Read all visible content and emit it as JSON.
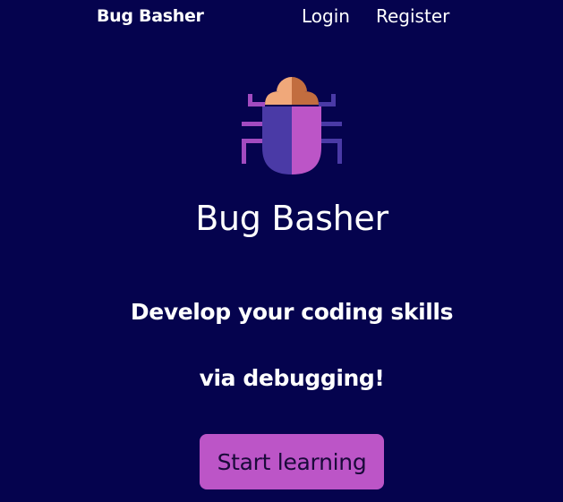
{
  "nav": {
    "brand": "Bug Basher",
    "login": "Login",
    "register": "Register"
  },
  "hero": {
    "logo_icon": "bug-icon",
    "title": "Bug Basher",
    "tagline_line1": "Develop your coding skills",
    "tagline_line2": "via debugging!",
    "cta_label": "Start learning"
  },
  "colors": {
    "background": "#05034e",
    "accent": "#bc55c7",
    "bug_left": "#4a3aa6",
    "bug_right": "#bc55c7",
    "bug_head_light": "#f0a87a",
    "bug_head_dark": "#c26d3f"
  }
}
